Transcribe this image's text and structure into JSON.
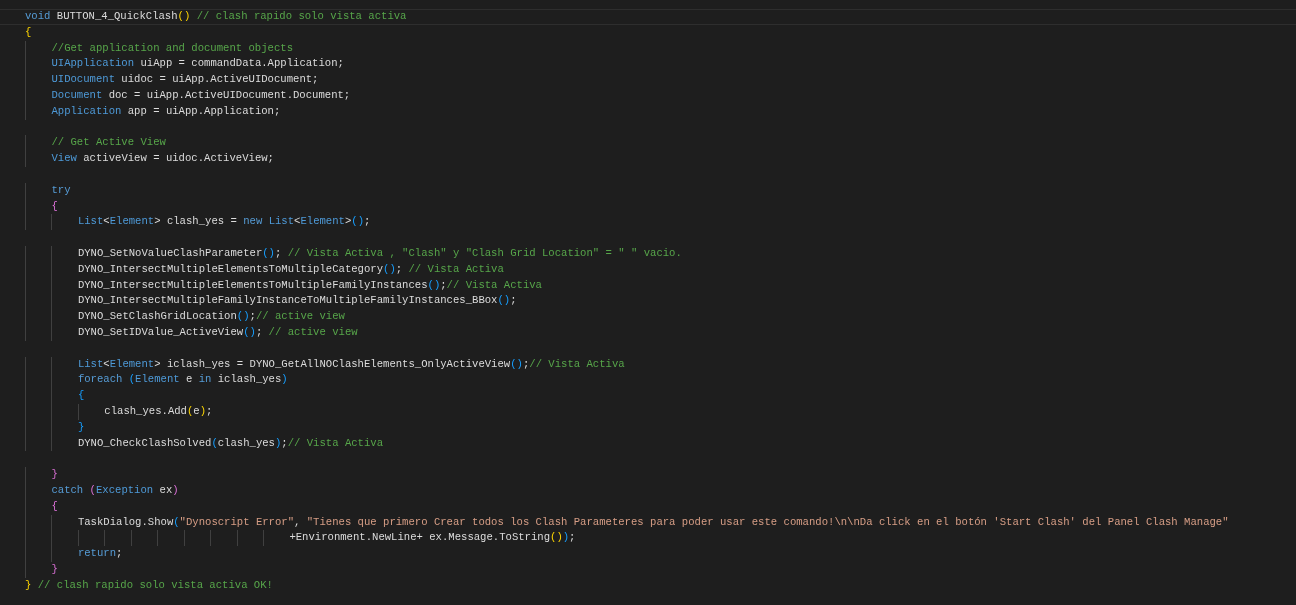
{
  "editor": {
    "lines": [
      {
        "kind": "code",
        "current": true,
        "tokens": [
          {
            "kind": "keyword",
            "text": "void"
          },
          {
            "kind": "plain",
            "text": " BUTTON_4_QuickClash"
          },
          {
            "kind": "bracket1",
            "text": "()"
          },
          {
            "kind": "comment",
            "text": " // clash rapido solo vista activa"
          }
        ]
      },
      {
        "kind": "code",
        "current": false,
        "tokens": [
          {
            "kind": "bracket1",
            "text": "{"
          }
        ]
      },
      {
        "kind": "code",
        "current": false,
        "tokens": [
          {
            "kind": "comment",
            "text": "    //Get application and document objects"
          }
        ]
      },
      {
        "kind": "code",
        "current": false,
        "tokens": [
          {
            "kind": "type",
            "text": "    UIApplication"
          },
          {
            "kind": "plain",
            "text": " uiApp = commandData.Application;"
          }
        ]
      },
      {
        "kind": "code",
        "current": false,
        "tokens": [
          {
            "kind": "type",
            "text": "    UIDocument"
          },
          {
            "kind": "plain",
            "text": " uidoc = uiApp.ActiveUIDocument;"
          }
        ]
      },
      {
        "kind": "code",
        "current": false,
        "tokens": [
          {
            "kind": "type",
            "text": "    Document"
          },
          {
            "kind": "plain",
            "text": " doc = uiApp.ActiveUIDocument.Document;"
          }
        ]
      },
      {
        "kind": "code",
        "current": false,
        "tokens": [
          {
            "kind": "type",
            "text": "    Application"
          },
          {
            "kind": "plain",
            "text": " app = uiApp.Application;"
          }
        ]
      },
      {
        "kind": "blank",
        "current": false
      },
      {
        "kind": "code",
        "current": false,
        "tokens": [
          {
            "kind": "comment",
            "text": "    // Get Active View"
          }
        ]
      },
      {
        "kind": "code",
        "current": false,
        "tokens": [
          {
            "kind": "type",
            "text": "    View"
          },
          {
            "kind": "plain",
            "text": " activeView = uidoc.ActiveView;"
          }
        ]
      },
      {
        "kind": "blank",
        "current": false
      },
      {
        "kind": "code",
        "current": false,
        "tokens": [
          {
            "kind": "keyword",
            "text": "    try"
          }
        ]
      },
      {
        "kind": "code",
        "current": false,
        "tokens": [
          {
            "kind": "bracket2",
            "text": "    {"
          }
        ]
      },
      {
        "kind": "code",
        "current": false,
        "tokens": [
          {
            "kind": "type",
            "text": "        List"
          },
          {
            "kind": "plain",
            "text": "<"
          },
          {
            "kind": "type",
            "text": "Element"
          },
          {
            "kind": "plain",
            "text": "> clash_yes = "
          },
          {
            "kind": "keyword",
            "text": "new "
          },
          {
            "kind": "type",
            "text": "List"
          },
          {
            "kind": "plain",
            "text": "<"
          },
          {
            "kind": "type",
            "text": "Element"
          },
          {
            "kind": "plain",
            "text": ">"
          },
          {
            "kind": "bracket3",
            "text": "()"
          },
          {
            "kind": "plain",
            "text": ";"
          }
        ]
      },
      {
        "kind": "blank",
        "current": false
      },
      {
        "kind": "code",
        "current": false,
        "tokens": [
          {
            "kind": "plain",
            "text": "        DYNO_SetNoValueClashParameter"
          },
          {
            "kind": "bracket3",
            "text": "()"
          },
          {
            "kind": "plain",
            "text": "; "
          },
          {
            "kind": "comment",
            "text": "// Vista Activa , \"Clash\" y \"Clash Grid Location\" = \" \" vacio."
          }
        ]
      },
      {
        "kind": "code",
        "current": false,
        "tokens": [
          {
            "kind": "plain",
            "text": "        DYNO_IntersectMultipleElementsToMultipleCategory"
          },
          {
            "kind": "bracket3",
            "text": "()"
          },
          {
            "kind": "plain",
            "text": "; "
          },
          {
            "kind": "comment",
            "text": "// Vista Activa"
          }
        ]
      },
      {
        "kind": "code",
        "current": false,
        "tokens": [
          {
            "kind": "plain",
            "text": "        DYNO_IntersectMultipleElementsToMultipleFamilyInstances"
          },
          {
            "kind": "bracket3",
            "text": "()"
          },
          {
            "kind": "plain",
            "text": ";"
          },
          {
            "kind": "comment",
            "text": "// Vista Activa"
          }
        ]
      },
      {
        "kind": "code",
        "current": false,
        "tokens": [
          {
            "kind": "plain",
            "text": "        DYNO_IntersectMultipleFamilyInstanceToMultipleFamilyInstances_BBox"
          },
          {
            "kind": "bracket3",
            "text": "()"
          },
          {
            "kind": "plain",
            "text": ";"
          }
        ]
      },
      {
        "kind": "code",
        "current": false,
        "tokens": [
          {
            "kind": "plain",
            "text": "        DYNO_SetClashGridLocation"
          },
          {
            "kind": "bracket3",
            "text": "()"
          },
          {
            "kind": "plain",
            "text": ";"
          },
          {
            "kind": "comment",
            "text": "// active view"
          }
        ]
      },
      {
        "kind": "code",
        "current": false,
        "tokens": [
          {
            "kind": "plain",
            "text": "        DYNO_SetIDValue_ActiveView"
          },
          {
            "kind": "bracket3",
            "text": "()"
          },
          {
            "kind": "plain",
            "text": "; "
          },
          {
            "kind": "comment",
            "text": "// active view"
          }
        ]
      },
      {
        "kind": "blank",
        "current": false
      },
      {
        "kind": "code",
        "current": false,
        "tokens": [
          {
            "kind": "type",
            "text": "        List"
          },
          {
            "kind": "plain",
            "text": "<"
          },
          {
            "kind": "type",
            "text": "Element"
          },
          {
            "kind": "plain",
            "text": "> iclash_yes = DYNO_GetAllNOClashElements_OnlyActiveView"
          },
          {
            "kind": "bracket3",
            "text": "()"
          },
          {
            "kind": "plain",
            "text": ";"
          },
          {
            "kind": "comment",
            "text": "// Vista Activa"
          }
        ]
      },
      {
        "kind": "code",
        "current": false,
        "tokens": [
          {
            "kind": "keyword",
            "text": "        foreach "
          },
          {
            "kind": "bracket3",
            "text": "("
          },
          {
            "kind": "type",
            "text": "Element"
          },
          {
            "kind": "plain",
            "text": " e "
          },
          {
            "kind": "keyword",
            "text": "in"
          },
          {
            "kind": "plain",
            "text": " iclash_yes"
          },
          {
            "kind": "bracket3",
            "text": ")"
          }
        ]
      },
      {
        "kind": "code",
        "current": false,
        "tokens": [
          {
            "kind": "bracket3",
            "text": "        {"
          }
        ]
      },
      {
        "kind": "code",
        "current": false,
        "tokens": [
          {
            "kind": "plain",
            "text": "            clash_yes.Add"
          },
          {
            "kind": "bracket1",
            "text": "("
          },
          {
            "kind": "plain",
            "text": "e"
          },
          {
            "kind": "bracket1",
            "text": ")"
          },
          {
            "kind": "plain",
            "text": ";"
          }
        ]
      },
      {
        "kind": "code",
        "current": false,
        "tokens": [
          {
            "kind": "bracket3",
            "text": "        }"
          }
        ]
      },
      {
        "kind": "code",
        "current": false,
        "tokens": [
          {
            "kind": "plain",
            "text": "        DYNO_CheckClashSolved"
          },
          {
            "kind": "bracket3",
            "text": "("
          },
          {
            "kind": "plain",
            "text": "clash_yes"
          },
          {
            "kind": "bracket3",
            "text": ")"
          },
          {
            "kind": "plain",
            "text": ";"
          },
          {
            "kind": "comment",
            "text": "// Vista Activa"
          }
        ]
      },
      {
        "kind": "blank",
        "current": false
      },
      {
        "kind": "code",
        "current": false,
        "tokens": [
          {
            "kind": "bracket2",
            "text": "    }"
          }
        ]
      },
      {
        "kind": "code",
        "current": false,
        "tokens": [
          {
            "kind": "keyword",
            "text": "    catch "
          },
          {
            "kind": "bracket2",
            "text": "("
          },
          {
            "kind": "type",
            "text": "Exception"
          },
          {
            "kind": "plain",
            "text": " ex"
          },
          {
            "kind": "bracket2",
            "text": ")"
          }
        ]
      },
      {
        "kind": "code",
        "current": false,
        "tokens": [
          {
            "kind": "bracket2",
            "text": "    {"
          }
        ]
      },
      {
        "kind": "code",
        "current": false,
        "tokens": [
          {
            "kind": "plain",
            "text": "        TaskDialog.Show"
          },
          {
            "kind": "bracket3",
            "text": "("
          },
          {
            "kind": "string",
            "text": "\"Dynoscript Error\""
          },
          {
            "kind": "plain",
            "text": ", "
          },
          {
            "kind": "string",
            "text": "\"Tienes que primero Crear todos los Clash Parameteres para poder usar este comando!\\n\\nDa click en el botón 'Start Clash' del Panel Clash Manage\""
          }
        ]
      },
      {
        "kind": "code",
        "current": false,
        "tokens": [
          {
            "kind": "plain",
            "text": "                                        +Environment.NewLine+ ex.Message.ToString"
          },
          {
            "kind": "bracket1",
            "text": "()"
          },
          {
            "kind": "bracket3",
            "text": ")"
          },
          {
            "kind": "plain",
            "text": ";"
          }
        ]
      },
      {
        "kind": "code",
        "current": false,
        "tokens": [
          {
            "kind": "keyword",
            "text": "        return"
          },
          {
            "kind": "plain",
            "text": ";"
          }
        ]
      },
      {
        "kind": "code",
        "current": false,
        "tokens": [
          {
            "kind": "bracket2",
            "text": "    }"
          }
        ]
      },
      {
        "kind": "code",
        "current": false,
        "tokens": [
          {
            "kind": "bracket1",
            "text": "}"
          },
          {
            "kind": "comment",
            "text": " // clash rapido solo vista activa OK!"
          }
        ]
      }
    ]
  }
}
